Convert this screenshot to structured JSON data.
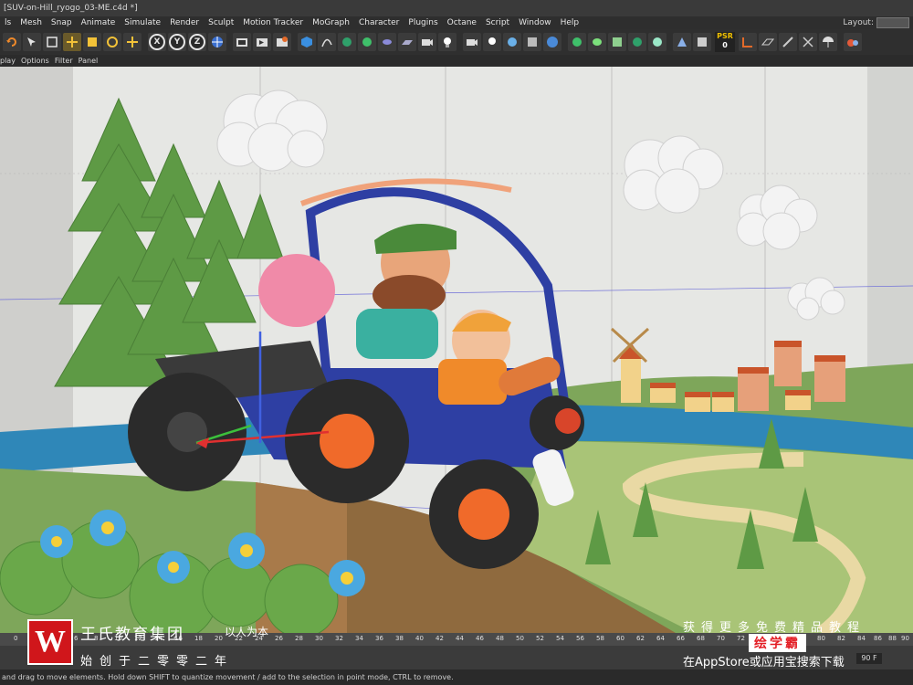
{
  "window": {
    "title": "[SUV-on-Hill_ryogo_03-ME.c4d *]"
  },
  "menu": {
    "items": [
      "ls",
      "Mesh",
      "Snap",
      "Animate",
      "Simulate",
      "Render",
      "Sculpt",
      "Motion Tracker",
      "MoGraph",
      "Character",
      "Plugins",
      "Octane",
      "Script",
      "Window",
      "Help"
    ],
    "layout_label": "Layout:"
  },
  "toolbar": {
    "axis_x": "X",
    "axis_y": "Y",
    "axis_z": "Z",
    "psr_label": "PSR",
    "psr_value": "0"
  },
  "viewport_menu": {
    "items": [
      "play",
      "Options",
      "Filter",
      "Panel"
    ]
  },
  "timeline": {
    "ticks": [
      "0",
      "2",
      "4",
      "6",
      "8",
      "10",
      "12",
      "14",
      "16",
      "18",
      "20",
      "22",
      "24",
      "26",
      "28",
      "30",
      "32",
      "34",
      "36",
      "38",
      "40",
      "42",
      "44",
      "46",
      "48",
      "50",
      "52",
      "54",
      "56",
      "58",
      "60",
      "62",
      "64",
      "66",
      "68",
      "70",
      "72",
      "74",
      "76",
      "78",
      "80",
      "82",
      "84",
      "86",
      "88",
      "90"
    ],
    "end_frame": "90 F"
  },
  "status": {
    "text": "and drag to move elements. Hold down SHIFT to quantize movement / add to the selection in point mode, CTRL to remove."
  },
  "watermark": {
    "logo": "W",
    "company": "王氏教育集团",
    "slogan": "以人为本",
    "founded": "始创于二零零二年",
    "promo": "获得更多免费精品教程",
    "brand": "绘学霸",
    "store": "在AppStore或应用宝搜索下载"
  },
  "colors": {
    "sky": "#e6e7e4",
    "grass": "#7ea65a",
    "water": "#2f87b8",
    "tree": "#5e9a45",
    "car": "#2e3fa3",
    "wheel_hub": "#f06a2a",
    "brand_red": "#d0161b"
  }
}
